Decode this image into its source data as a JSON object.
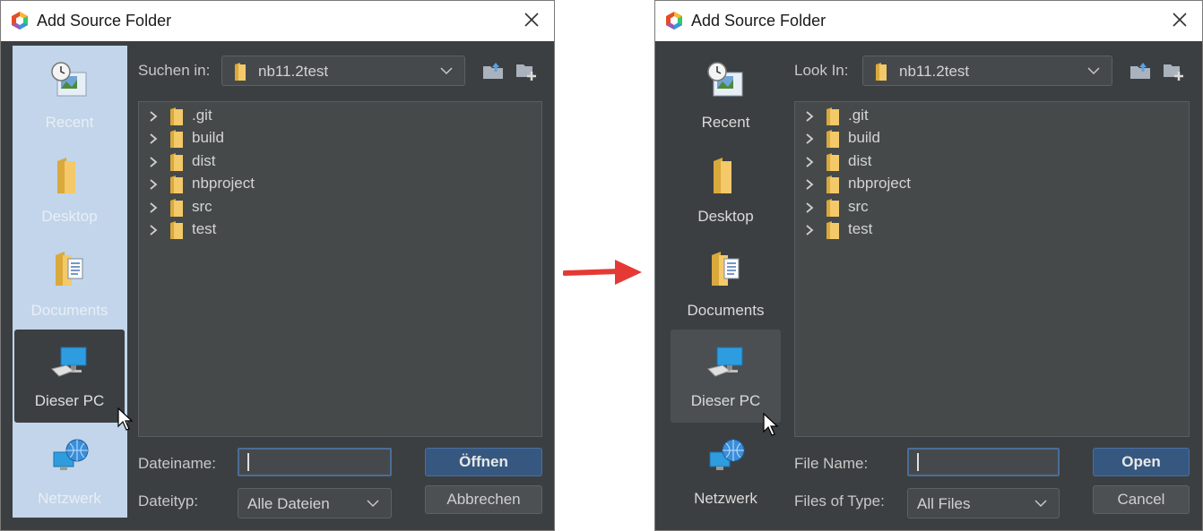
{
  "colors": {
    "dialog_bg": "#3c3f41",
    "sidebar_highlight_left": "#c2d5ea",
    "primary_button": "#365880",
    "folder_yellow": "#f3c969",
    "arrow_red": "#e53935"
  },
  "left": {
    "title": "Add Source Folder",
    "look_in_label": "Suchen in:",
    "look_in_value": "nb11.2test",
    "places": [
      {
        "label": "Recent",
        "icon": "recent-icon"
      },
      {
        "label": "Desktop",
        "icon": "desktop-folder-icon"
      },
      {
        "label": "Documents",
        "icon": "documents-folder-icon"
      },
      {
        "label": "Dieser PC",
        "icon": "computer-icon"
      },
      {
        "label": "Netzwerk",
        "icon": "network-icon"
      }
    ],
    "files": [
      ".git",
      "build",
      "dist",
      "nbproject",
      "src",
      "test"
    ],
    "filename_label": "Dateiname:",
    "filename_value": "",
    "filetype_label": "Dateityp:",
    "filetype_value": "Alle Dateien",
    "open_label": "Öffnen",
    "cancel_label": "Abbrechen"
  },
  "right": {
    "title": "Add Source Folder",
    "look_in_label": "Look In:",
    "look_in_value": "nb11.2test",
    "places": [
      {
        "label": "Recent",
        "icon": "recent-icon"
      },
      {
        "label": "Desktop",
        "icon": "desktop-folder-icon"
      },
      {
        "label": "Documents",
        "icon": "documents-folder-icon"
      },
      {
        "label": "Dieser PC",
        "icon": "computer-icon"
      },
      {
        "label": "Netzwerk",
        "icon": "network-icon"
      }
    ],
    "files": [
      ".git",
      "build",
      "dist",
      "nbproject",
      "src",
      "test"
    ],
    "filename_label": "File Name:",
    "filename_value": "",
    "filetype_label": "Files of Type:",
    "filetype_value": "All Files",
    "open_label": "Open",
    "cancel_label": "Cancel"
  }
}
